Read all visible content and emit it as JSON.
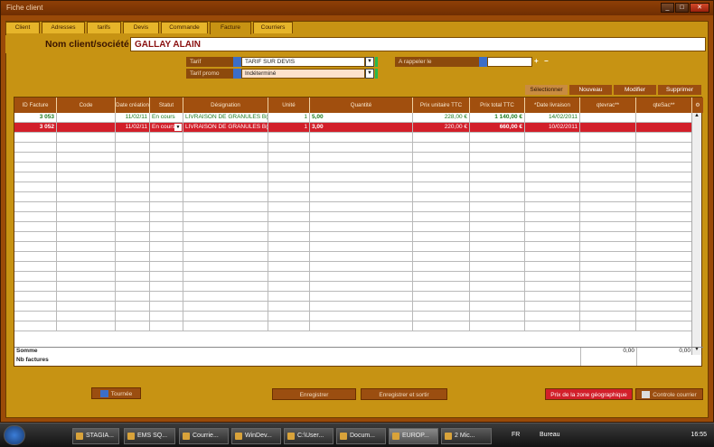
{
  "window": {
    "title": "Fiche client"
  },
  "tabs": [
    "Client",
    "Adresses",
    "tarifs",
    "Devis",
    "Commande",
    "Facture",
    "Courriers"
  ],
  "client": {
    "label": "Nom client/société",
    "value": "GALLAY ALAIN"
  },
  "tarif": {
    "label": "Tarif",
    "value": "TARIF SUR DEVIS"
  },
  "tarif_promo": {
    "label": "Tarif promo",
    "value": "Indéterminé"
  },
  "rappel": {
    "label": "A rappeler le",
    "value": "",
    "plus": "+",
    "minus": "−"
  },
  "table_buttons": [
    "Sélectionner",
    "Nouveau",
    "Modifier",
    "Supprimer"
  ],
  "columns": [
    "ID Facture",
    "Code",
    "Date création",
    "Statut",
    "Désignation",
    "Unité",
    "Quantité",
    "Prix unitaire TTC",
    "Prix total TTC",
    "*Date livraison",
    "qtevrac**",
    "qteSac**"
  ],
  "rows": [
    [
      "3 053",
      "",
      "11/02/11",
      "En cours",
      "LIVRAISON DE GRANULES B(",
      "1",
      "5,00",
      "228,00 €",
      "1 140,00 €",
      "14/02/2011",
      "",
      ""
    ],
    [
      "3 052",
      "",
      "11/02/11",
      "En cours",
      "LIVRAISON DE GRANULES B(",
      "1",
      "3,00",
      "220,00 €",
      "660,00 €",
      "10/02/2011",
      "",
      ""
    ]
  ],
  "footer": {
    "somme": "Somme",
    "nb": "Nb factures",
    "total_vrac": "0,00",
    "total_sac": "0,00"
  },
  "buttons": {
    "tournee": "Tournée",
    "enregistrer": "Enregistrer",
    "enregistrer_sortir": "Enregistrer et sortir",
    "prix_zone": "Prix de la zone géographique",
    "controle": "Controle courrier"
  },
  "taskbar": {
    "items": [
      "STAGIA...",
      "EMS SQ...",
      "Courrie...",
      "WinDev...",
      "C:\\User...",
      "Docum...",
      "EUROP...",
      "2 Mic..."
    ],
    "lang": "FR",
    "bureau": "Bureau",
    "time": "16:55"
  },
  "colors": {
    "accent": "#c79313",
    "row_selected": "#d21f2a",
    "header": "#a14f0e"
  }
}
